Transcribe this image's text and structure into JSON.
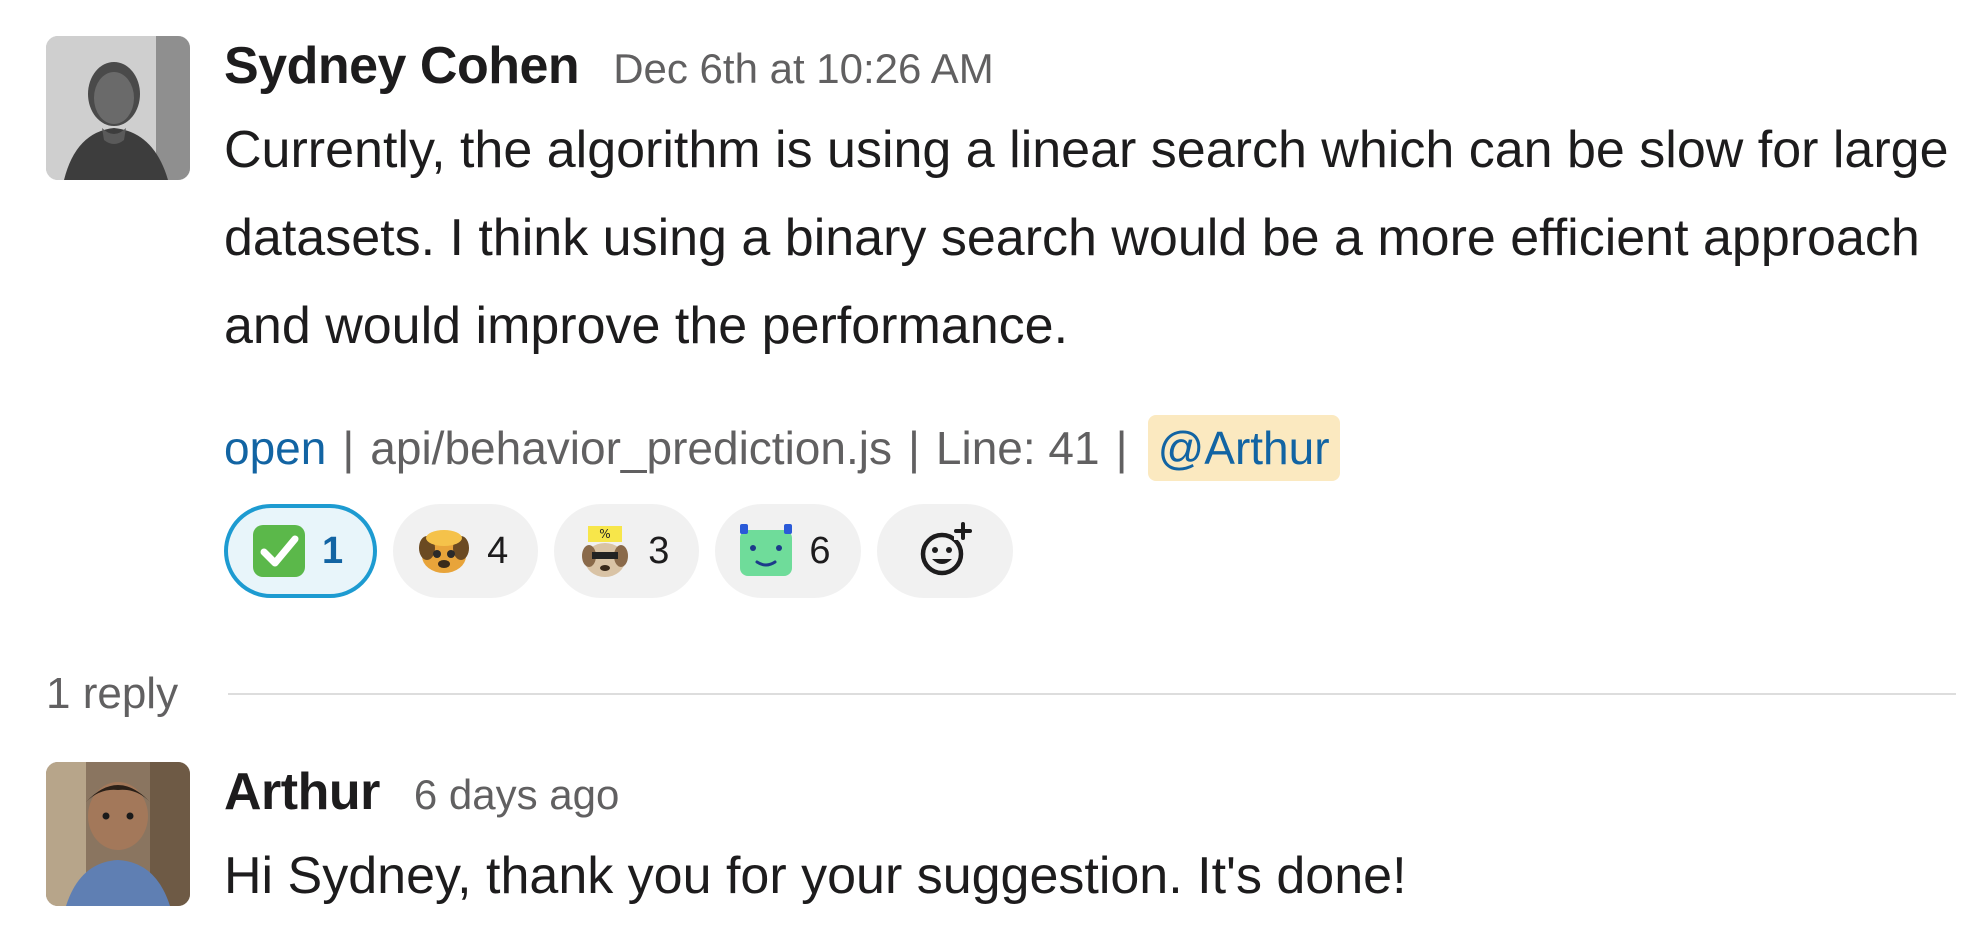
{
  "main_message": {
    "author": "Sydney Cohen",
    "timestamp": "Dec 6th at 10:26 AM",
    "text": "Currently, the algorithm is using a linear search which can be slow for large datasets. I think using a binary search would be a more efficient approach and would improve the performance.",
    "meta": {
      "status_link": "open",
      "separator": "|",
      "file": "api/behavior_prediction.js",
      "line_label": "Line: 41",
      "mention": "@Arthur"
    },
    "reactions": [
      {
        "icon": "check-mark-emoji",
        "count": "1",
        "active": true
      },
      {
        "icon": "dog-emoji",
        "count": "4",
        "active": false
      },
      {
        "icon": "dog-percent-emoji",
        "count": "3",
        "active": false
      },
      {
        "icon": "green-blob-emoji",
        "count": "6",
        "active": false
      }
    ],
    "add_reaction_icon": "add-reaction-icon"
  },
  "thread": {
    "reply_count": "1 reply"
  },
  "reply_message": {
    "author": "Arthur",
    "timestamp": "6 days ago",
    "text": "Hi Sydney, thank you for your suggestion. It's done!"
  },
  "colors": {
    "link": "#1264a3",
    "mention_bg": "#fbe9c0",
    "active_reaction_border": "#1d9bd1",
    "reaction_bg": "#f1f1f1",
    "muted_text": "#616061"
  }
}
